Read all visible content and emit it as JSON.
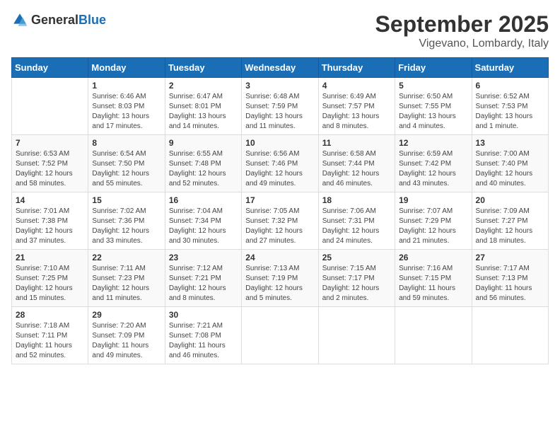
{
  "header": {
    "logo_general": "General",
    "logo_blue": "Blue",
    "month_title": "September 2025",
    "location": "Vigevano, Lombardy, Italy"
  },
  "weekdays": [
    "Sunday",
    "Monday",
    "Tuesday",
    "Wednesday",
    "Thursday",
    "Friday",
    "Saturday"
  ],
  "weeks": [
    [
      {
        "day": "",
        "sunrise": "",
        "sunset": "",
        "daylight": ""
      },
      {
        "day": "1",
        "sunrise": "Sunrise: 6:46 AM",
        "sunset": "Sunset: 8:03 PM",
        "daylight": "Daylight: 13 hours and 17 minutes."
      },
      {
        "day": "2",
        "sunrise": "Sunrise: 6:47 AM",
        "sunset": "Sunset: 8:01 PM",
        "daylight": "Daylight: 13 hours and 14 minutes."
      },
      {
        "day": "3",
        "sunrise": "Sunrise: 6:48 AM",
        "sunset": "Sunset: 7:59 PM",
        "daylight": "Daylight: 13 hours and 11 minutes."
      },
      {
        "day": "4",
        "sunrise": "Sunrise: 6:49 AM",
        "sunset": "Sunset: 7:57 PM",
        "daylight": "Daylight: 13 hours and 8 minutes."
      },
      {
        "day": "5",
        "sunrise": "Sunrise: 6:50 AM",
        "sunset": "Sunset: 7:55 PM",
        "daylight": "Daylight: 13 hours and 4 minutes."
      },
      {
        "day": "6",
        "sunrise": "Sunrise: 6:52 AM",
        "sunset": "Sunset: 7:53 PM",
        "daylight": "Daylight: 13 hours and 1 minute."
      }
    ],
    [
      {
        "day": "7",
        "sunrise": "Sunrise: 6:53 AM",
        "sunset": "Sunset: 7:52 PM",
        "daylight": "Daylight: 12 hours and 58 minutes."
      },
      {
        "day": "8",
        "sunrise": "Sunrise: 6:54 AM",
        "sunset": "Sunset: 7:50 PM",
        "daylight": "Daylight: 12 hours and 55 minutes."
      },
      {
        "day": "9",
        "sunrise": "Sunrise: 6:55 AM",
        "sunset": "Sunset: 7:48 PM",
        "daylight": "Daylight: 12 hours and 52 minutes."
      },
      {
        "day": "10",
        "sunrise": "Sunrise: 6:56 AM",
        "sunset": "Sunset: 7:46 PM",
        "daylight": "Daylight: 12 hours and 49 minutes."
      },
      {
        "day": "11",
        "sunrise": "Sunrise: 6:58 AM",
        "sunset": "Sunset: 7:44 PM",
        "daylight": "Daylight: 12 hours and 46 minutes."
      },
      {
        "day": "12",
        "sunrise": "Sunrise: 6:59 AM",
        "sunset": "Sunset: 7:42 PM",
        "daylight": "Daylight: 12 hours and 43 minutes."
      },
      {
        "day": "13",
        "sunrise": "Sunrise: 7:00 AM",
        "sunset": "Sunset: 7:40 PM",
        "daylight": "Daylight: 12 hours and 40 minutes."
      }
    ],
    [
      {
        "day": "14",
        "sunrise": "Sunrise: 7:01 AM",
        "sunset": "Sunset: 7:38 PM",
        "daylight": "Daylight: 12 hours and 37 minutes."
      },
      {
        "day": "15",
        "sunrise": "Sunrise: 7:02 AM",
        "sunset": "Sunset: 7:36 PM",
        "daylight": "Daylight: 12 hours and 33 minutes."
      },
      {
        "day": "16",
        "sunrise": "Sunrise: 7:04 AM",
        "sunset": "Sunset: 7:34 PM",
        "daylight": "Daylight: 12 hours and 30 minutes."
      },
      {
        "day": "17",
        "sunrise": "Sunrise: 7:05 AM",
        "sunset": "Sunset: 7:32 PM",
        "daylight": "Daylight: 12 hours and 27 minutes."
      },
      {
        "day": "18",
        "sunrise": "Sunrise: 7:06 AM",
        "sunset": "Sunset: 7:31 PM",
        "daylight": "Daylight: 12 hours and 24 minutes."
      },
      {
        "day": "19",
        "sunrise": "Sunrise: 7:07 AM",
        "sunset": "Sunset: 7:29 PM",
        "daylight": "Daylight: 12 hours and 21 minutes."
      },
      {
        "day": "20",
        "sunrise": "Sunrise: 7:09 AM",
        "sunset": "Sunset: 7:27 PM",
        "daylight": "Daylight: 12 hours and 18 minutes."
      }
    ],
    [
      {
        "day": "21",
        "sunrise": "Sunrise: 7:10 AM",
        "sunset": "Sunset: 7:25 PM",
        "daylight": "Daylight: 12 hours and 15 minutes."
      },
      {
        "day": "22",
        "sunrise": "Sunrise: 7:11 AM",
        "sunset": "Sunset: 7:23 PM",
        "daylight": "Daylight: 12 hours and 11 minutes."
      },
      {
        "day": "23",
        "sunrise": "Sunrise: 7:12 AM",
        "sunset": "Sunset: 7:21 PM",
        "daylight": "Daylight: 12 hours and 8 minutes."
      },
      {
        "day": "24",
        "sunrise": "Sunrise: 7:13 AM",
        "sunset": "Sunset: 7:19 PM",
        "daylight": "Daylight: 12 hours and 5 minutes."
      },
      {
        "day": "25",
        "sunrise": "Sunrise: 7:15 AM",
        "sunset": "Sunset: 7:17 PM",
        "daylight": "Daylight: 12 hours and 2 minutes."
      },
      {
        "day": "26",
        "sunrise": "Sunrise: 7:16 AM",
        "sunset": "Sunset: 7:15 PM",
        "daylight": "Daylight: 11 hours and 59 minutes."
      },
      {
        "day": "27",
        "sunrise": "Sunrise: 7:17 AM",
        "sunset": "Sunset: 7:13 PM",
        "daylight": "Daylight: 11 hours and 56 minutes."
      }
    ],
    [
      {
        "day": "28",
        "sunrise": "Sunrise: 7:18 AM",
        "sunset": "Sunset: 7:11 PM",
        "daylight": "Daylight: 11 hours and 52 minutes."
      },
      {
        "day": "29",
        "sunrise": "Sunrise: 7:20 AM",
        "sunset": "Sunset: 7:09 PM",
        "daylight": "Daylight: 11 hours and 49 minutes."
      },
      {
        "day": "30",
        "sunrise": "Sunrise: 7:21 AM",
        "sunset": "Sunset: 7:08 PM",
        "daylight": "Daylight: 11 hours and 46 minutes."
      },
      {
        "day": "",
        "sunrise": "",
        "sunset": "",
        "daylight": ""
      },
      {
        "day": "",
        "sunrise": "",
        "sunset": "",
        "daylight": ""
      },
      {
        "day": "",
        "sunrise": "",
        "sunset": "",
        "daylight": ""
      },
      {
        "day": "",
        "sunrise": "",
        "sunset": "",
        "daylight": ""
      }
    ]
  ]
}
